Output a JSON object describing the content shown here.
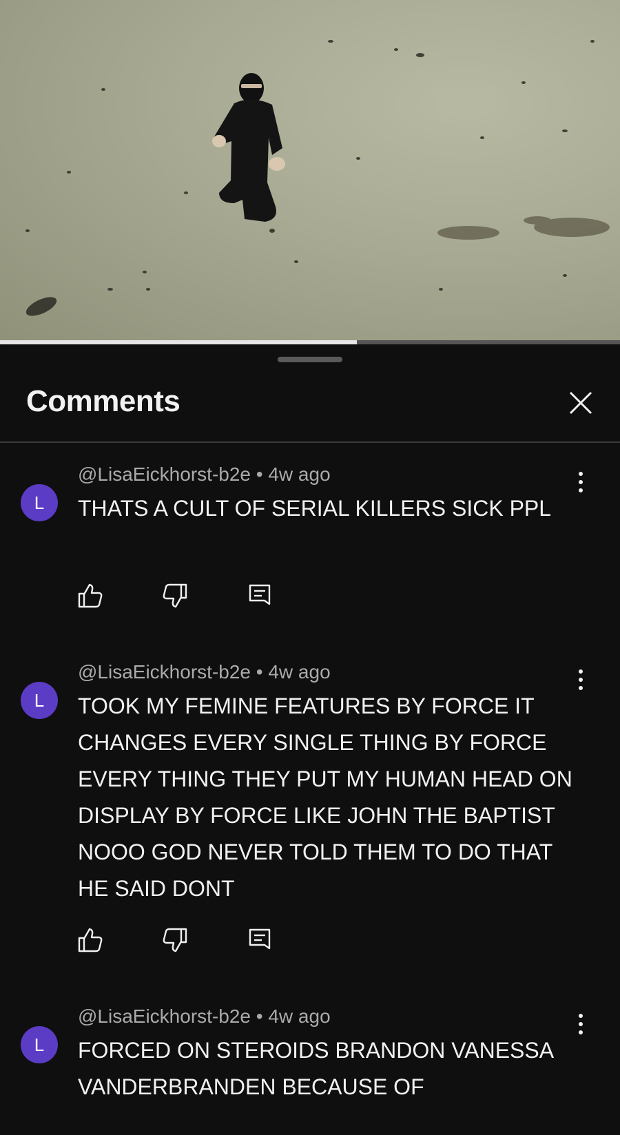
{
  "video": {
    "progress": 0.575
  },
  "sheet": {
    "title": "Comments",
    "close_icon": "close-icon"
  },
  "comments": [
    {
      "avatar_letter": "L",
      "author": "@LisaEickhorst-b2e",
      "separator": "•",
      "time": "4w ago",
      "text": "THATS A CULT OF SERIAL KILLERS SICK PPL"
    },
    {
      "avatar_letter": "L",
      "author": "@LisaEickhorst-b2e",
      "separator": "•",
      "time": "4w ago",
      "text": "TOOK MY FEMINE FEATURES BY FORCE IT CHANGES EVERY SINGLE THING BY FORCE EVERY THING THEY PUT MY HUMAN HEAD ON DISPLAY BY FORCE LIKE JOHN THE BAPTIST NOOO GOD NEVER TOLD THEM TO DO THAT HE SAID DONT"
    },
    {
      "avatar_letter": "L",
      "author": "@LisaEickhorst-b2e",
      "separator": "•",
      "time": "4w ago",
      "text": "FORCED ON STEROIDS BRANDON VANESSA VANDERBRANDEN BECAUSE OF"
    }
  ],
  "colors": {
    "avatar": "#5b3cc4",
    "background": "#0f0f0f",
    "meta_text": "#aaaaaa"
  }
}
